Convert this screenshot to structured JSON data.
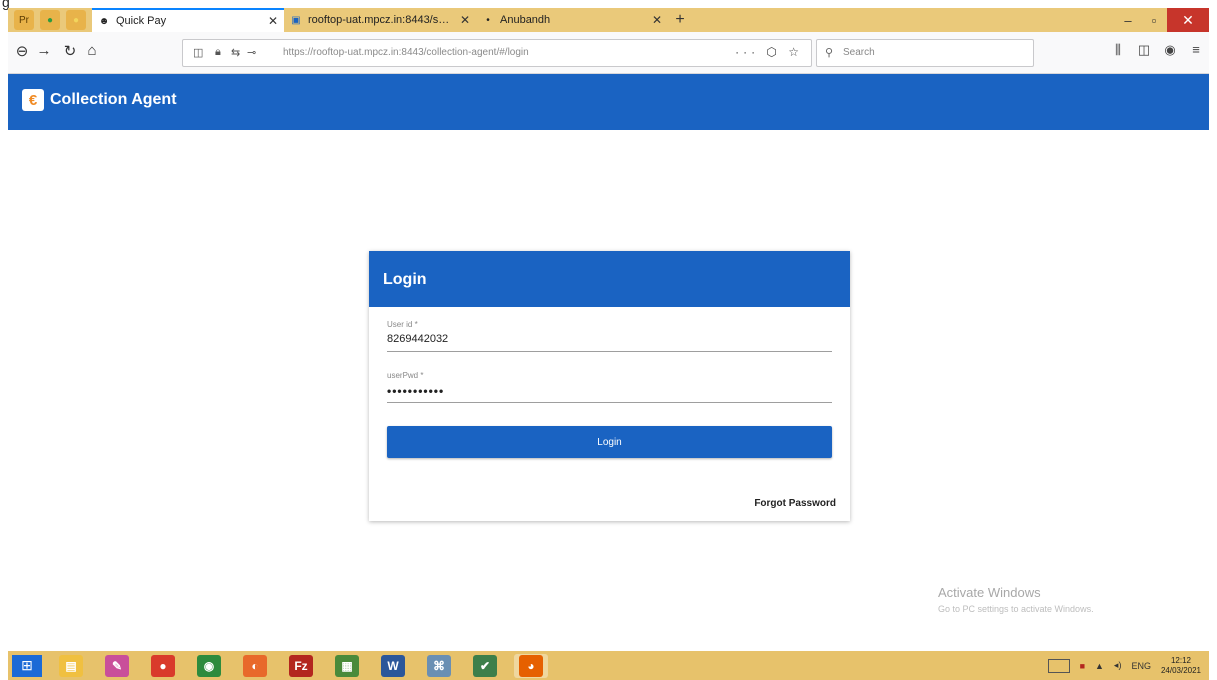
{
  "top_text": "g",
  "browser": {
    "tabs": [
      {
        "label": "Quick Pay",
        "favicon": "☻",
        "active": true
      },
      {
        "label": "rooftop-uat.mpcz.in:8443/serv…",
        "favicon": "▣",
        "active": false
      },
      {
        "label": "Anubandh",
        "favicon": "•",
        "active": false
      }
    ],
    "url": "https://rooftop-uat.mpcz.in:8443/collection-agent/#/login",
    "search_placeholder": "Search",
    "url_actions": "··· ⬡ ☆"
  },
  "app": {
    "title": "Collection Agent",
    "logo_glyph": "€"
  },
  "login": {
    "heading": "Login",
    "user_label": "User id *",
    "user_value": "8269442032",
    "pw_label": "userPwd *",
    "pw_value": "•••••••••••",
    "button": "Login",
    "forgot": "Forgot Password"
  },
  "watermark": {
    "title": "Activate Windows",
    "subtitle": "Go to PC settings to activate Windows."
  },
  "taskbar": {
    "lang": "ENG",
    "time": "12:12",
    "date": "24/03/2021",
    "apps": [
      {
        "name": "file-explorer",
        "color": "#f0c040",
        "glyph": "▤"
      },
      {
        "name": "paint",
        "color": "#c94f9a",
        "glyph": "✎"
      },
      {
        "name": "chrome",
        "color": "#d93a2b",
        "glyph": "●"
      },
      {
        "name": "green-app",
        "color": "#2e8b3d",
        "glyph": "◉"
      },
      {
        "name": "orange-app",
        "color": "#e8692a",
        "glyph": "◐"
      },
      {
        "name": "filezilla",
        "color": "#b3261e",
        "glyph": "Fz"
      },
      {
        "name": "notepad-app",
        "color": "#4a8a3a",
        "glyph": "▦"
      },
      {
        "name": "word",
        "color": "#2b579a",
        "glyph": "W"
      },
      {
        "name": "network-app",
        "color": "#6a8fb3",
        "glyph": "⌘"
      },
      {
        "name": "checker-app",
        "color": "#3d7f4a",
        "glyph": "✔"
      },
      {
        "name": "firefox",
        "color": "#e66000",
        "glyph": "◕"
      }
    ]
  }
}
